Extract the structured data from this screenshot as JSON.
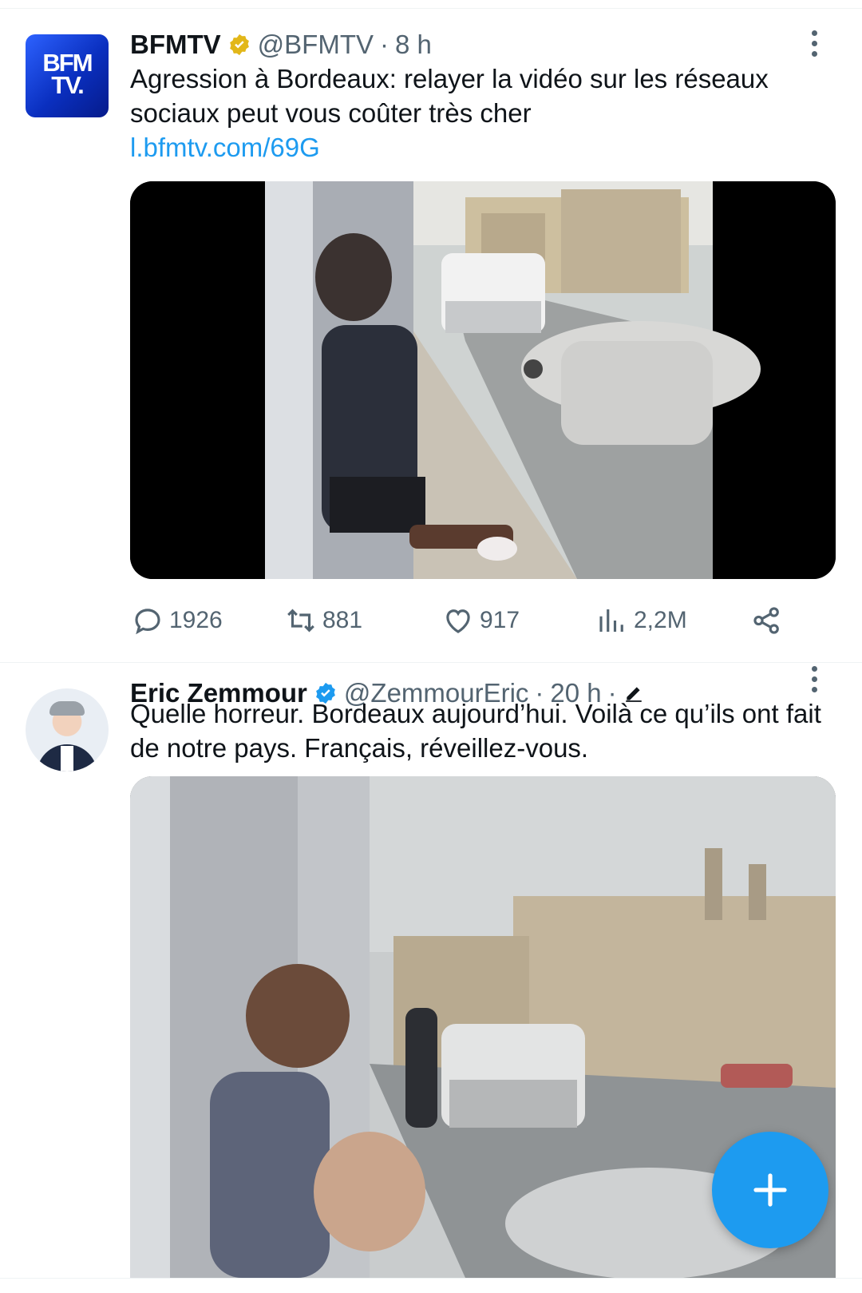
{
  "tweets": [
    {
      "avatar_text": "BFM TV.",
      "name": "BFMTV",
      "verified": "gold",
      "handle": "@BFMTV",
      "separator": "·",
      "time": "8 h",
      "text": "Agression à Bordeaux: relayer la vidéo sur les réseaux sociaux peut vous coûter très cher",
      "link": "l.bfmtv.com/69G",
      "stats": {
        "replies": "1926",
        "retweets": "881",
        "likes": "917",
        "views": "2,2M"
      }
    },
    {
      "name": "Eric Zemmour",
      "verified": "blue",
      "handle": "@ZemmourEric",
      "separator": "·",
      "time": "20 h",
      "separator2": "·",
      "text": "Quelle horreur. Bordeaux aujourd’hui. Voilà ce qu’ils ont fait de notre pays. Français, réveillez-vous."
    }
  ],
  "colors": {
    "accent": "#1d9bf0",
    "gold_badge": "#e2b719",
    "muted": "#536471"
  },
  "fab": {
    "icon": "plus-icon"
  }
}
